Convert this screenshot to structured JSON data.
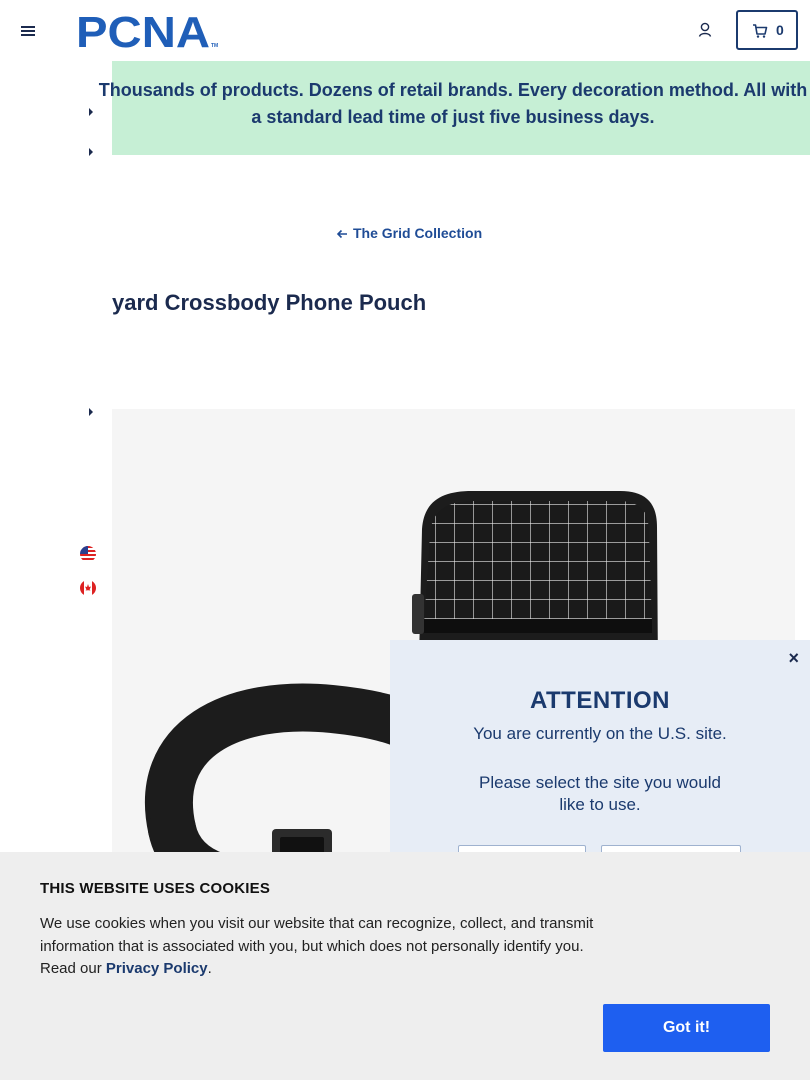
{
  "header": {
    "logo_text": "PCNA",
    "logo_tm": "TM",
    "cart_count": "0",
    "icons": {
      "menu": "hamburger-menu-icon",
      "account": "user-icon",
      "cart": "cart-icon"
    }
  },
  "banner": {
    "text": "Thousands of products. Dozens of retail brands. Every decoration method. All with a standard lead time of just five business days.",
    "color": "#c6efd5"
  },
  "back_link": {
    "label": "The Grid Collection",
    "icon": "arrow-left-icon"
  },
  "product": {
    "title": "yard Crossbody Phone Pouch"
  },
  "site_flags": [
    {
      "name": "us-flag-icon"
    },
    {
      "name": "canada-flag-icon"
    }
  ],
  "modal": {
    "close_label": "×",
    "title": "ATTENTION",
    "line1": "You are currently on the U.S. site.",
    "line2": "Please select the site you would",
    "line3": "like to use."
  },
  "cookie_banner": {
    "title": "THIS WEBSITE USES COOKIES",
    "body": "We use cookies when you visit our website that can recognize, collect, and transmit information that is associated with you, but which does not personally identify you. Read our ",
    "link_label": "Privacy Policy",
    "after_link": ".",
    "button_label": "Got it!",
    "button_color": "#1e5ff0"
  },
  "colors": {
    "navy": "#1b3a6e",
    "link_blue": "#1f4c96",
    "modal_bg": "#e7edf6"
  }
}
